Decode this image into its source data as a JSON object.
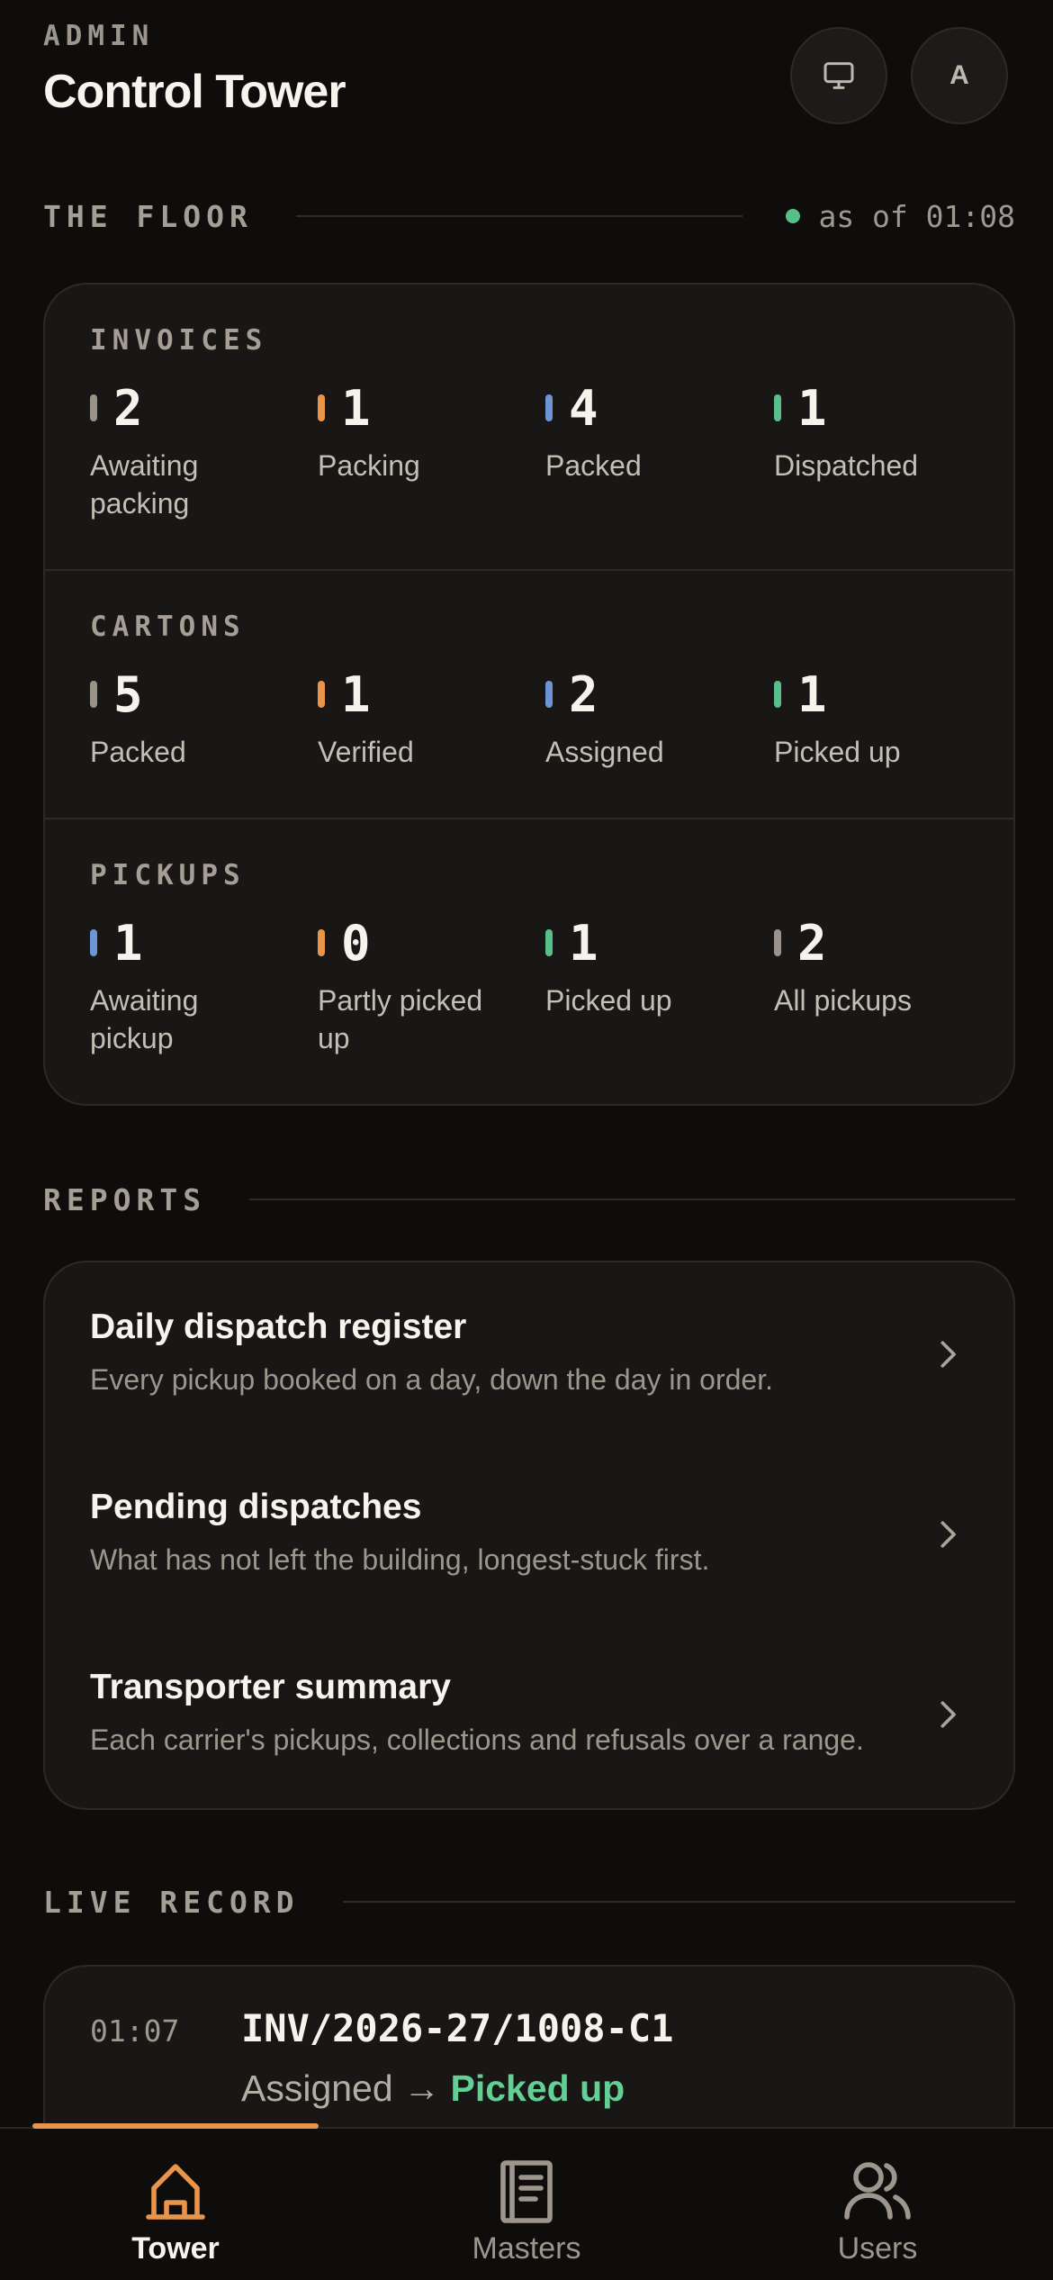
{
  "header": {
    "eyebrow": "ADMIN",
    "title": "Control Tower",
    "avatar_initial": "A",
    "monitor_icon": "monitor-icon"
  },
  "floor": {
    "section_label": "THE FLOOR",
    "status_text": "as of 01:08",
    "status_color": "#57c08a",
    "groups": [
      {
        "title": "INVOICES",
        "metrics": [
          {
            "value": "2",
            "label": "Awaiting packing",
            "color": "#9a938a"
          },
          {
            "value": "1",
            "label": "Packing",
            "color": "#e8944a"
          },
          {
            "value": "4",
            "label": "Packed",
            "color": "#6d95d6"
          },
          {
            "value": "1",
            "label": "Dispatched",
            "color": "#57c08a"
          }
        ]
      },
      {
        "title": "CARTONS",
        "metrics": [
          {
            "value": "5",
            "label": "Packed",
            "color": "#9a938a"
          },
          {
            "value": "1",
            "label": "Verified",
            "color": "#e8944a"
          },
          {
            "value": "2",
            "label": "Assigned",
            "color": "#6d95d6"
          },
          {
            "value": "1",
            "label": "Picked up",
            "color": "#57c08a"
          }
        ]
      },
      {
        "title": "PICKUPS",
        "metrics": [
          {
            "value": "1",
            "label": "Awaiting pickup",
            "color": "#6d95d6"
          },
          {
            "value": "0",
            "label": "Partly picked up",
            "color": "#e8944a"
          },
          {
            "value": "1",
            "label": "Picked up",
            "color": "#57c08a"
          },
          {
            "value": "2",
            "label": "All pickups",
            "color": "#9a938a"
          }
        ]
      }
    ]
  },
  "reports": {
    "section_label": "REPORTS",
    "items": [
      {
        "title": "Daily dispatch register",
        "description": "Every pickup booked on a day, down the day in order."
      },
      {
        "title": "Pending dispatches",
        "description": "What has not left the building, longest-stuck first."
      },
      {
        "title": "Transporter summary",
        "description": "Each carrier's pickups, collections and refusals over a range."
      }
    ]
  },
  "live_record": {
    "section_label": "LIVE RECORD",
    "entries": [
      {
        "time": "01:07",
        "reference": "INV/2026-27/1008-C1",
        "from": "Assigned",
        "arrow": "→",
        "to": "Picked up"
      }
    ]
  },
  "nav": {
    "accent": "#e8944a",
    "items": [
      {
        "label": "Tower",
        "icon": "home-icon",
        "active": true
      },
      {
        "label": "Masters",
        "icon": "document-icon",
        "active": false
      },
      {
        "label": "Users",
        "icon": "users-icon",
        "active": false
      }
    ]
  }
}
